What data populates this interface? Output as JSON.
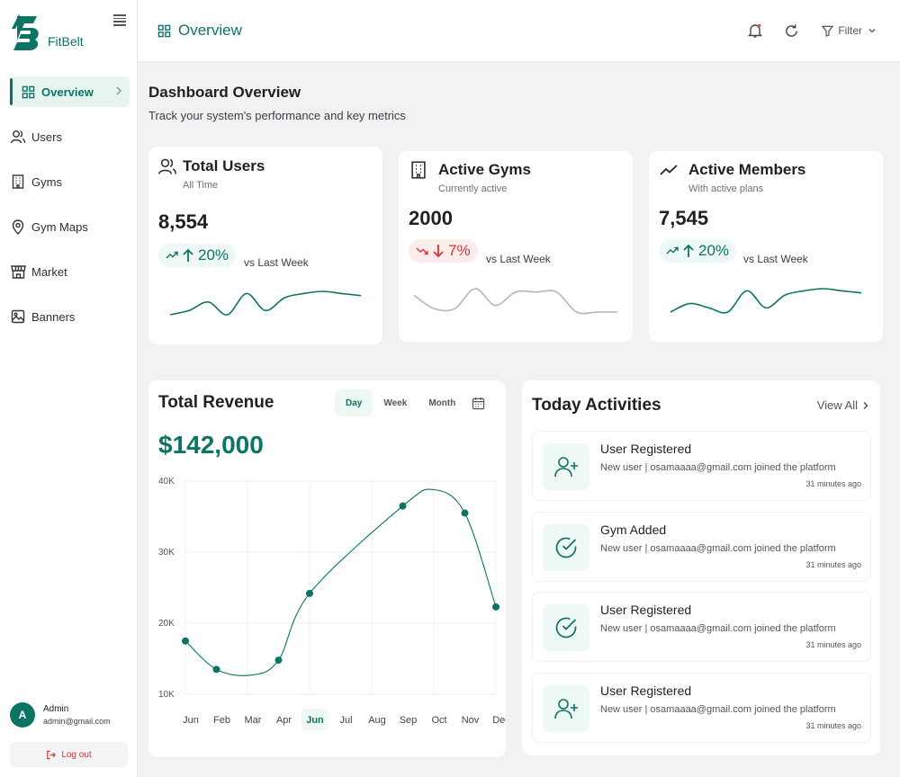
{
  "app": {
    "name": "FitBelt"
  },
  "sidebar": {
    "items": [
      {
        "label": "Overview",
        "icon": "grid-icon"
      },
      {
        "label": "Users",
        "icon": "users-icon"
      },
      {
        "label": "Gyms",
        "icon": "building-icon"
      },
      {
        "label": "Gym Maps",
        "icon": "map-pin-icon"
      },
      {
        "label": "Market",
        "icon": "store-icon"
      },
      {
        "label": "Banners",
        "icon": "image-icon"
      }
    ],
    "user": {
      "initial": "A",
      "name": "Admin",
      "email": "admin@gmail.com"
    },
    "logout_label": "Log out"
  },
  "topbar": {
    "title": "Overview",
    "filter_label": "Filter"
  },
  "header": {
    "title": "Dashboard Overview",
    "subtitle": "Track your system's performance and key metrics"
  },
  "stats": [
    {
      "title": "Total Users",
      "subtitle": "All Time",
      "value": "8,554",
      "change": "20%",
      "direction": "up",
      "compare": "vs Last Week",
      "spark": [
        3,
        4,
        6,
        3,
        8,
        4,
        7,
        8,
        8.5,
        8,
        7.5
      ]
    },
    {
      "title": "Active Gyms",
      "subtitle": "Currently active",
      "value": "2000",
      "change": "7%",
      "direction": "down",
      "compare": "vs Last Week",
      "spark": [
        7,
        3,
        3,
        9,
        4,
        8,
        8,
        8,
        2,
        2,
        2
      ]
    },
    {
      "title": "Active Members",
      "subtitle": "With active plans",
      "value": "7,545",
      "change": "20%",
      "direction": "up",
      "compare": "vs Last Week",
      "spark": [
        3,
        5,
        4,
        3,
        8,
        4,
        7,
        8,
        8.5,
        8,
        7.5
      ]
    }
  ],
  "revenue": {
    "title": "Total Revenue",
    "periods": [
      "Day",
      "Week",
      "Month"
    ],
    "active_period": "Day",
    "amount": "$142,000"
  },
  "chart_data": {
    "type": "line",
    "categories": [
      "Jun",
      "Feb",
      "Mar",
      "Apr",
      "Jun",
      "Jul",
      "Aug",
      "Sep",
      "Oct",
      "Nov",
      "Dec"
    ],
    "highlight_category_index": 4,
    "values": [
      17500,
      13500,
      null,
      14800,
      24200,
      null,
      null,
      36500,
      null,
      35500,
      22300
    ],
    "ylim": [
      10000,
      40000
    ],
    "yticks": [
      "10K",
      "20K",
      "30K",
      "40K"
    ],
    "xlabel": "",
    "ylabel": "",
    "grid": true,
    "colors": {
      "line": "#0c7462"
    }
  },
  "activities": {
    "title": "Today Activities",
    "view_all": "View All",
    "items": [
      {
        "title": "User Registered",
        "desc": "New user | osamaaaa@gmail.com joined the platform",
        "time": "31 minutes ago",
        "icon": "user-plus-icon"
      },
      {
        "title": "Gym Added",
        "desc": "New user | osamaaaa@gmail.com joined the platform",
        "time": "31 minutes ago",
        "icon": "check-circle-icon"
      },
      {
        "title": "User Registered",
        "desc": "New user | osamaaaa@gmail.com joined the platform",
        "time": "31 minutes ago",
        "icon": "check-circle-icon"
      },
      {
        "title": "User Registered",
        "desc": "New user | osamaaaa@gmail.com joined the platform",
        "time": "31 minutes ago",
        "icon": "user-plus-icon"
      }
    ]
  }
}
